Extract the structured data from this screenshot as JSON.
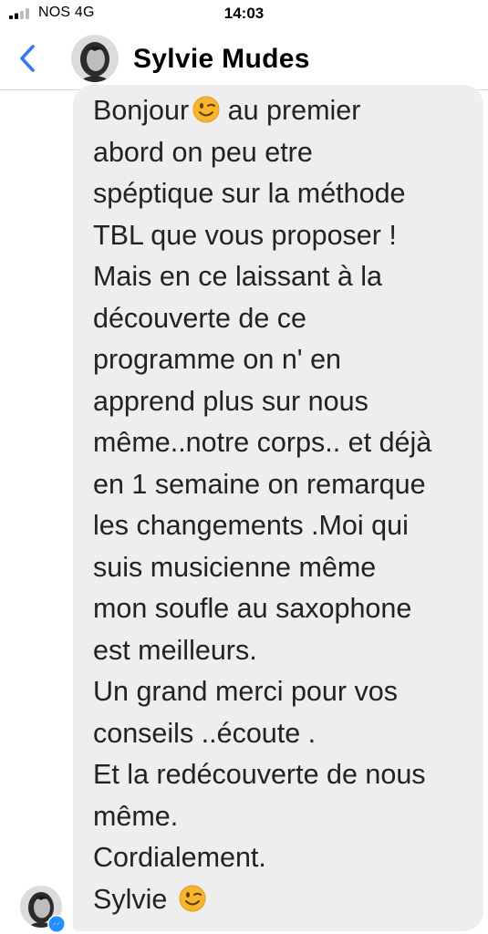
{
  "status_bar": {
    "carrier": "NOS 4G",
    "time": "14:03",
    "signal_icon": "signal-strength-icon"
  },
  "header": {
    "back_icon": "chevron-left-icon",
    "contact_name": "Sylvie Mudes",
    "avatar": "avatar-photo",
    "accent_color": "#3478f6"
  },
  "message": {
    "bubble_color": "#eeeeee",
    "lines": [
      "Bonjour",
      "abord on peu etre",
      "spéptique sur la méthode",
      "TBL que vous proposer !",
      "Mais en ce laissant à la",
      "découverte de ce",
      "programme on n' en",
      "apprend plus sur nous",
      "même..notre corps.. et déjà",
      "en 1 semaine on remarque",
      "les changements .Moi qui",
      "suis musicienne même",
      "mon soufle au saxophone",
      "est meilleurs.",
      "Un grand merci pour vos",
      "conseils ..écoute .",
      "Et la redécouverte de nous",
      "même.",
      "Cordialement.",
      "Sylvie"
    ],
    "line1_rest": "au premier",
    "emoji_icon": "winking-face-emoji-icon"
  },
  "sender": {
    "avatar": "avatar-photo",
    "badge_icon": "messenger-badge-icon"
  }
}
